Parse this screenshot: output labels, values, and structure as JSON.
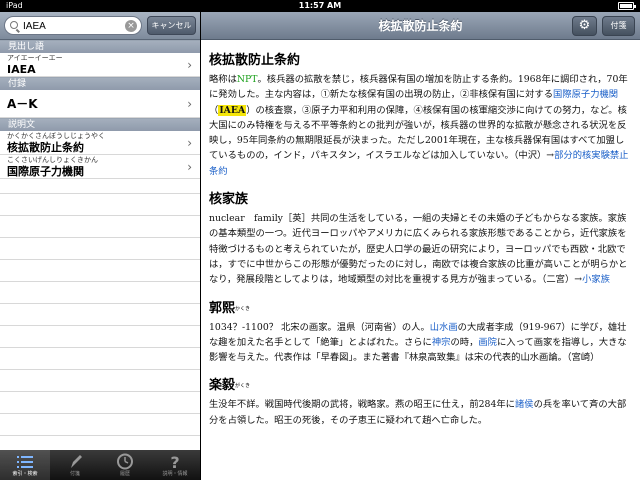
{
  "status": {
    "device": "iPad",
    "time": "11:57 AM"
  },
  "search": {
    "value": "IAEA",
    "cancel_label": "キャンセル"
  },
  "sections": [
    {
      "title": "見出し語",
      "rows": [
        {
          "reading": "アイエーイーエー",
          "head": "IAEA"
        }
      ]
    },
    {
      "title": "付録",
      "rows": [
        {
          "reading": "",
          "head": "A－K"
        }
      ]
    },
    {
      "title": "説明文",
      "rows": [
        {
          "reading": "かくかくさんぼうしじょうやく",
          "head": "核拡散防止条約"
        },
        {
          "reading": "こくさいげんしりょくきかん",
          "head": "国際原子力機関"
        }
      ]
    }
  ],
  "tabs": [
    {
      "label": "索引・検索",
      "icon": "list-icon",
      "active": true
    },
    {
      "label": "付箋",
      "icon": "pencil-icon",
      "active": false
    },
    {
      "label": "履歴",
      "icon": "clock-icon",
      "active": false
    },
    {
      "label": "説明・情報",
      "icon": "question-icon",
      "active": false
    }
  ],
  "navbar": {
    "title": "核拡散防止条約",
    "gear_icon": "⚙",
    "tag_label": "付箋"
  },
  "entries": [
    {
      "title": "核拡散防止条約",
      "ruby": "",
      "body_parts": [
        {
          "t": "略称は"
        },
        {
          "t": "NPT",
          "c": "green"
        },
        {
          "t": "。核兵器の拡散を禁じ，核兵器保有国の増加を防止する条約。1968年に調印され，70年に発効した。主な内容は，①新たな核保有国の出現の防止，②非核保有国に対する"
        },
        {
          "t": "国際原子力機関",
          "c": "link"
        },
        {
          "t": "（"
        },
        {
          "t": "IAEA",
          "c": "mark"
        },
        {
          "t": "）の核査察，③原子力平和利用の保障，④核保有国の核軍縮交渉に向けての努力，など。核大国にのみ特権を与える不平等条約との批判が強いが，核兵器の世界的な拡散が懸念される状況を反映し，95年同条約の無期限延長が決まった。ただし2001年現在，主な核兵器保有国はすべて加盟しているものの，インド，パキスタン，イスラエルなどは加入していない。（中沢）→"
        },
        {
          "t": "部分的核実験禁止条約",
          "c": "link"
        }
      ]
    },
    {
      "title": "核家族",
      "ruby": "",
      "body_parts": [
        {
          "t": "nuclear　family［英］共同の生活をしている，一組の夫婦とその未婚の子どもからなる家族。家族の基本類型の一つ。近代ヨーロッパやアメリカに広くみられる家族形態であることから，近代家族を特徴づけるものと考えられていたが，歴史人口学の最近の研究により，ヨーロッパでも西欧・北欧では，すでに中世からこの形態が優勢だったのに対し，南欧では複合家族の比重が高いことが明らかとなり，発展段階としてよりは，地域類型の対比を重視する見方が強まっている。（二宮）→"
        },
        {
          "t": "小家族",
          "c": "link"
        }
      ]
    },
    {
      "title": "郭熙",
      "ruby": "かくき",
      "body_parts": [
        {
          "t": "1034？-1100？ 北宋の画家。温県（河南省）の人。"
        },
        {
          "t": "山水画",
          "c": "link"
        },
        {
          "t": "の大成者李成（919-967）に学び，雄壮な趣を加えた名手として「絶筆」とよばれた。さらに"
        },
        {
          "t": "神宗",
          "c": "link"
        },
        {
          "t": "の時，"
        },
        {
          "t": "画院",
          "c": "link"
        },
        {
          "t": "に入って画家を指導し，大きな影響を与えた。代表作は「早春図」。また著書『林泉高致集』は宋の代表的山水画論。（宮崎）"
        }
      ]
    },
    {
      "title": "楽毅",
      "ruby": "がくき",
      "body_parts": [
        {
          "t": "生没年不詳。戦国時代後期の武将，戦略家。燕の昭王に仕え，前284年に"
        },
        {
          "t": "諸侯",
          "c": "link"
        },
        {
          "t": "の兵を率いて斉の大部分を占領した。昭王の死後，その子恵王に疑われて趙へ亡命した。"
        }
      ]
    }
  ]
}
